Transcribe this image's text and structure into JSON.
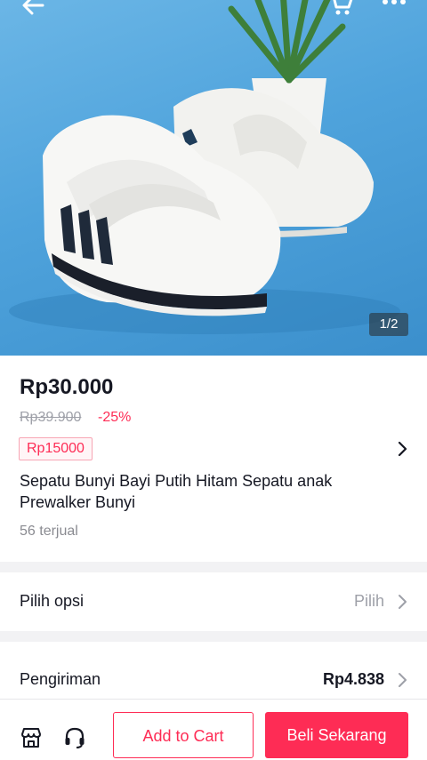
{
  "hero": {
    "image_counter": "1/2"
  },
  "product": {
    "price": "Rp30.000",
    "original_price": "Rp39.900",
    "discount": "-25%",
    "voucher": "Rp15000",
    "title": "Sepatu Bunyi Bayi Putih Hitam Sepatu anak Prewalker Bunyi",
    "sold": "56 terjual"
  },
  "options": {
    "label": "Pilih opsi",
    "value": "Pilih"
  },
  "shipping": {
    "label": "Pengiriman",
    "value": "Rp4.838"
  },
  "actions": {
    "add_to_cart": "Add to Cart",
    "buy_now": "Beli Sekarang"
  },
  "icons": {
    "back": "back-arrow-icon",
    "cart": "cart-icon",
    "more": "more-icon",
    "shop": "shop-icon",
    "support": "headset-icon",
    "chevron": "chevron-right-icon"
  },
  "colors": {
    "accent": "#fe2c55",
    "hero_background": "#4fa3dc"
  }
}
